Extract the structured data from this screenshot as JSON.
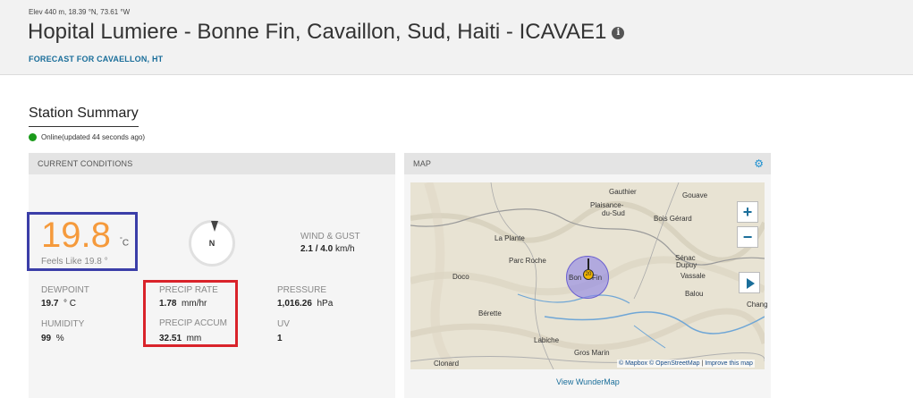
{
  "header": {
    "elevation": "Elev 440 m, 18.39 °N, 73.61 °W",
    "title": "Hopital Lumiere - Bonne Fin, Cavaillon, Sud, Haiti - ICAVAE1",
    "forecast_link": "FORECAST FOR CAVAELLON, HT"
  },
  "summary": {
    "title": "Station Summary",
    "status": "Online(updated 44 seconds ago)",
    "status_color": "#1a9a1a"
  },
  "conditions": {
    "heading": "CURRENT CONDITIONS",
    "temperature": "19.8",
    "temp_unit": "C",
    "feels_like": "Feels Like 19.8 °",
    "compass_label": "N",
    "wind_label": "WIND & GUST",
    "wind_value": "2.1",
    "gust_value": "/ 4.0",
    "wind_unit": "km/h",
    "dewpoint_label": "DEWPOINT",
    "dewpoint_value": "19.7",
    "dewpoint_unit": "° C",
    "humidity_label": "HUMIDITY",
    "humidity_value": "99",
    "humidity_unit": "%",
    "precip_rate_label": "PRECIP RATE",
    "precip_rate_value": "1.78",
    "precip_rate_unit": "mm/hr",
    "precip_accum_label": "PRECIP ACCUM",
    "precip_accum_value": "32.51",
    "precip_accum_unit": "mm",
    "pressure_label": "PRESSURE",
    "pressure_value": "1,016.26",
    "pressure_unit": "hPa",
    "uv_label": "UV",
    "uv_value": "1",
    "temp_color": "#f59a3c",
    "highlight_blue": "#3b3ea8",
    "highlight_red": "#d9232a"
  },
  "map": {
    "heading": "MAP",
    "zoom_in": "+",
    "zoom_out": "−",
    "marker_value": "20",
    "places": {
      "gauthier": "Gauthier",
      "gouave": "Gouave",
      "plaisance": "Plaisance-",
      "du_sud": "du-Sud",
      "bois_gerard": "Bois Gérard",
      "la_plante": "La Plante",
      "parc_roche": "Parc Roche",
      "senac": "Sénac",
      "dupuy": "Dupuy",
      "vassale": "Vassale",
      "doco": "Doco",
      "bonne_fin_left": "Bon",
      "bonne_fin_right": "Fin",
      "balou": "Balou",
      "chang": "Chang",
      "berette": "Bérette",
      "labiche": "Labiche",
      "gros_marin": "Gros Marin",
      "clonard": "Clonard"
    },
    "attribution_mapbox": "© Mapbox",
    "attribution_osm": "© OpenStreetMap",
    "attribution_improve": "Improve this map",
    "wundermap_link": "View WunderMap"
  }
}
